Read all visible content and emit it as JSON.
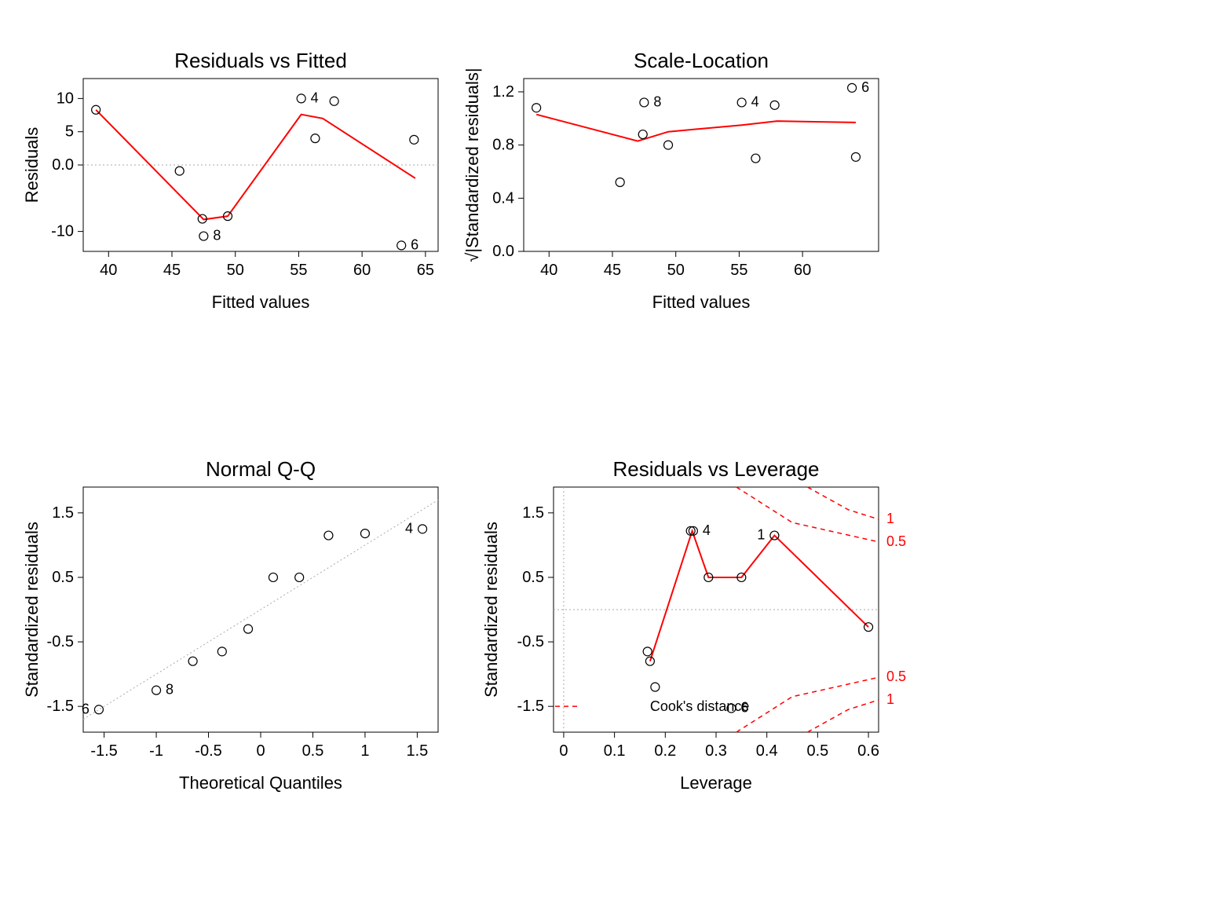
{
  "chart_data": [
    {
      "id": "residuals_vs_fitted",
      "type": "scatter",
      "title": "Residuals vs Fitted",
      "xlabel": "Fitted values",
      "ylabel": "Residuals",
      "xlim": [
        38,
        66
      ],
      "ylim": [
        -13,
        13
      ],
      "xticks": [
        40,
        45,
        50,
        55,
        60,
        65
      ],
      "yticks": [
        -10,
        0,
        5,
        10
      ],
      "points": [
        {
          "x": 39.0,
          "y": 8.3
        },
        {
          "x": 45.6,
          "y": -0.9
        },
        {
          "x": 47.4,
          "y": -8.1
        },
        {
          "x": 47.5,
          "y": -10.7,
          "label": "8"
        },
        {
          "x": 49.4,
          "y": -7.7
        },
        {
          "x": 55.2,
          "y": 10.0,
          "label": "4"
        },
        {
          "x": 56.3,
          "y": 4.0
        },
        {
          "x": 57.8,
          "y": 9.6
        },
        {
          "x": 63.1,
          "y": -12.1,
          "label": "6"
        },
        {
          "x": 64.1,
          "y": 3.8
        }
      ],
      "smooth": [
        {
          "x": 39.0,
          "y": 8.3
        },
        {
          "x": 47.5,
          "y": -8.2
        },
        {
          "x": 49.4,
          "y": -7.7
        },
        {
          "x": 55.2,
          "y": 7.6
        },
        {
          "x": 56.9,
          "y": 7.0
        },
        {
          "x": 64.2,
          "y": -2.0
        }
      ],
      "hline": 0
    },
    {
      "id": "scale_location",
      "type": "scatter",
      "title": "Scale-Location",
      "xlabel": "Fitted values",
      "ylabel": "√|Standardized residuals|",
      "xlim": [
        38,
        66
      ],
      "ylim": [
        0.0,
        1.3
      ],
      "xticks": [
        40,
        45,
        50,
        55,
        60
      ],
      "yticks": [
        0.0,
        0.4,
        0.8,
        1.2
      ],
      "points": [
        {
          "x": 39.0,
          "y": 1.08
        },
        {
          "x": 45.6,
          "y": 0.52
        },
        {
          "x": 47.4,
          "y": 0.88
        },
        {
          "x": 47.5,
          "y": 1.12,
          "label": "8"
        },
        {
          "x": 49.4,
          "y": 0.8
        },
        {
          "x": 55.2,
          "y": 1.12,
          "label": "4"
        },
        {
          "x": 56.3,
          "y": 0.7
        },
        {
          "x": 57.8,
          "y": 1.1
        },
        {
          "x": 63.9,
          "y": 1.23,
          "label": "6"
        },
        {
          "x": 64.2,
          "y": 0.71
        }
      ],
      "smooth": [
        {
          "x": 39.0,
          "y": 1.03
        },
        {
          "x": 47.0,
          "y": 0.83
        },
        {
          "x": 49.4,
          "y": 0.9
        },
        {
          "x": 55.2,
          "y": 0.95
        },
        {
          "x": 58.0,
          "y": 0.98
        },
        {
          "x": 64.2,
          "y": 0.97
        }
      ]
    },
    {
      "id": "normal_qq",
      "type": "scatter",
      "title": "Normal Q-Q",
      "xlabel": "Theoretical Quantiles",
      "ylabel": "Standardized residuals",
      "xlim": [
        -1.7,
        1.7
      ],
      "ylim": [
        -1.9,
        1.9
      ],
      "xticks": [
        -1.5,
        -1.0,
        -0.5,
        0.0,
        0.5,
        1.0,
        1.5
      ],
      "yticks": [
        -1.5,
        -0.5,
        0.5,
        1.5
      ],
      "points": [
        {
          "x": -1.55,
          "y": -1.55,
          "label": "6",
          "labelSide": "left"
        },
        {
          "x": -1.0,
          "y": -1.25,
          "label": "8"
        },
        {
          "x": -0.65,
          "y": -0.8
        },
        {
          "x": -0.37,
          "y": -0.65
        },
        {
          "x": -0.12,
          "y": -0.3
        },
        {
          "x": 0.12,
          "y": 0.5
        },
        {
          "x": 0.37,
          "y": 0.5
        },
        {
          "x": 0.65,
          "y": 1.15
        },
        {
          "x": 1.0,
          "y": 1.18
        },
        {
          "x": 1.55,
          "y": 1.25,
          "label": "4",
          "labelSide": "left"
        }
      ],
      "qqline": {
        "x1": -1.7,
        "y1": -1.7,
        "x2": 1.7,
        "y2": 1.7
      }
    },
    {
      "id": "residuals_vs_leverage",
      "type": "scatter",
      "title": "Residuals vs Leverage",
      "xlabel": "Leverage",
      "ylabel": "Standardized residuals",
      "xlim": [
        -0.02,
        0.62
      ],
      "ylim": [
        -1.9,
        1.9
      ],
      "xticks": [
        0.0,
        0.1,
        0.2,
        0.3,
        0.4,
        0.5,
        0.6
      ],
      "yticks": [
        -1.5,
        -0.5,
        0.5,
        1.5
      ],
      "points": [
        {
          "x": 0.165,
          "y": -0.65
        },
        {
          "x": 0.17,
          "y": -0.8
        },
        {
          "x": 0.18,
          "y": -1.2
        },
        {
          "x": 0.25,
          "y": 1.22
        },
        {
          "x": 0.255,
          "y": 1.22,
          "label": "4"
        },
        {
          "x": 0.285,
          "y": 0.5
        },
        {
          "x": 0.33,
          "y": -1.53,
          "label": "6"
        },
        {
          "x": 0.35,
          "y": 0.5
        },
        {
          "x": 0.415,
          "y": 1.15,
          "label": "1",
          "labelSide": "left"
        },
        {
          "x": 0.6,
          "y": -0.27
        }
      ],
      "smooth": [
        {
          "x": 0.17,
          "y": -0.8
        },
        {
          "x": 0.253,
          "y": 1.22
        },
        {
          "x": 0.285,
          "y": 0.5
        },
        {
          "x": 0.35,
          "y": 0.5
        },
        {
          "x": 0.415,
          "y": 1.15
        },
        {
          "x": 0.6,
          "y": -0.27
        }
      ],
      "hline": 0,
      "vline": 0,
      "cook_label": "Cook's distance",
      "cook_levels": [
        0.5,
        1,
        0.5,
        1
      ]
    }
  ]
}
